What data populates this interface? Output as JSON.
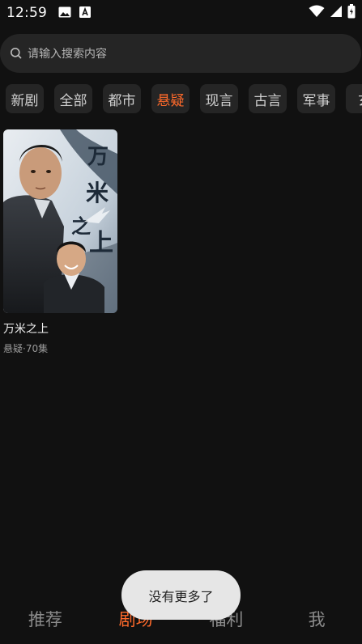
{
  "status_bar": {
    "time": "12:59",
    "left_icons": [
      "image-icon",
      "font-download-icon"
    ],
    "right_icons": [
      "wifi-icon",
      "signal-icon",
      "battery-icon"
    ]
  },
  "search": {
    "placeholder": "请输入搜索内容"
  },
  "categories": [
    {
      "label": "新剧",
      "active": false
    },
    {
      "label": "全部",
      "active": false
    },
    {
      "label": "都市",
      "active": false
    },
    {
      "label": "悬疑",
      "active": true
    },
    {
      "label": "现言",
      "active": false
    },
    {
      "label": "古言",
      "active": false
    },
    {
      "label": "军事",
      "active": false
    },
    {
      "label": "玄",
      "active": false
    }
  ],
  "dramas": [
    {
      "title": "万米之上",
      "meta": "悬疑·70集",
      "poster_title": "万米之上"
    }
  ],
  "toast": "没有更多了",
  "bottom_nav": [
    {
      "label": "推荐",
      "active": false
    },
    {
      "label": "剧场",
      "active": true
    },
    {
      "label": "福利",
      "active": false
    },
    {
      "label": "我",
      "active": false
    }
  ],
  "colors": {
    "background": "#111111",
    "accent": "#ff6a2b",
    "chip_bg": "#252525"
  }
}
